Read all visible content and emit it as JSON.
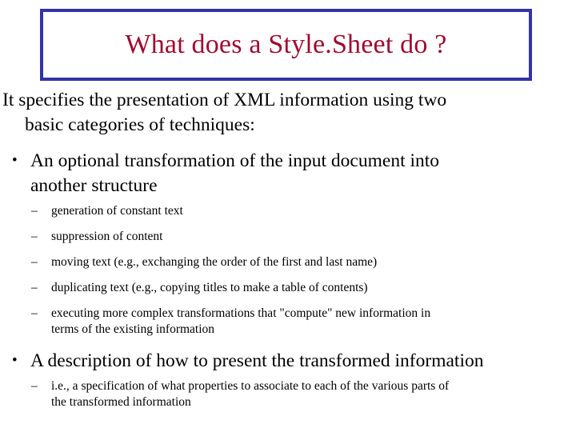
{
  "slide": {
    "title": "What does a Style.Sheet do ?",
    "title_color": "#a00b31",
    "title_border_color": "#3333a8",
    "background_color": "#ffffff",
    "text_color": "#000000",
    "intro": {
      "line1": "It specifies the presentation of XML information using two",
      "line2": "basic categories of techniques:"
    },
    "bullets": [
      {
        "marker": "•",
        "line1": "An optional transformation of the input document into",
        "line2": "another structure",
        "subitems": [
          {
            "marker": "–",
            "line1": "generation of constant text",
            "line2": ""
          },
          {
            "marker": "–",
            "line1": "suppression of content",
            "line2": ""
          },
          {
            "marker": "–",
            "line1": "moving text (e.g., exchanging the order of the first and last name)",
            "line2": ""
          },
          {
            "marker": "–",
            "line1": "duplicating text (e.g., copying titles to make a table of contents)",
            "line2": ""
          },
          {
            "marker": "–",
            "line1": "executing more complex transformations that \"compute\" new information in",
            "line2": "terms of the existing information"
          }
        ]
      },
      {
        "marker": "•",
        "line1": "A description of how to present the transformed information",
        "line2": "",
        "subitems": [
          {
            "marker": "–",
            "line1": "i.e., a specification of what properties to associate to each of the various parts of",
            "line2": "the transformed information"
          }
        ]
      }
    ]
  }
}
